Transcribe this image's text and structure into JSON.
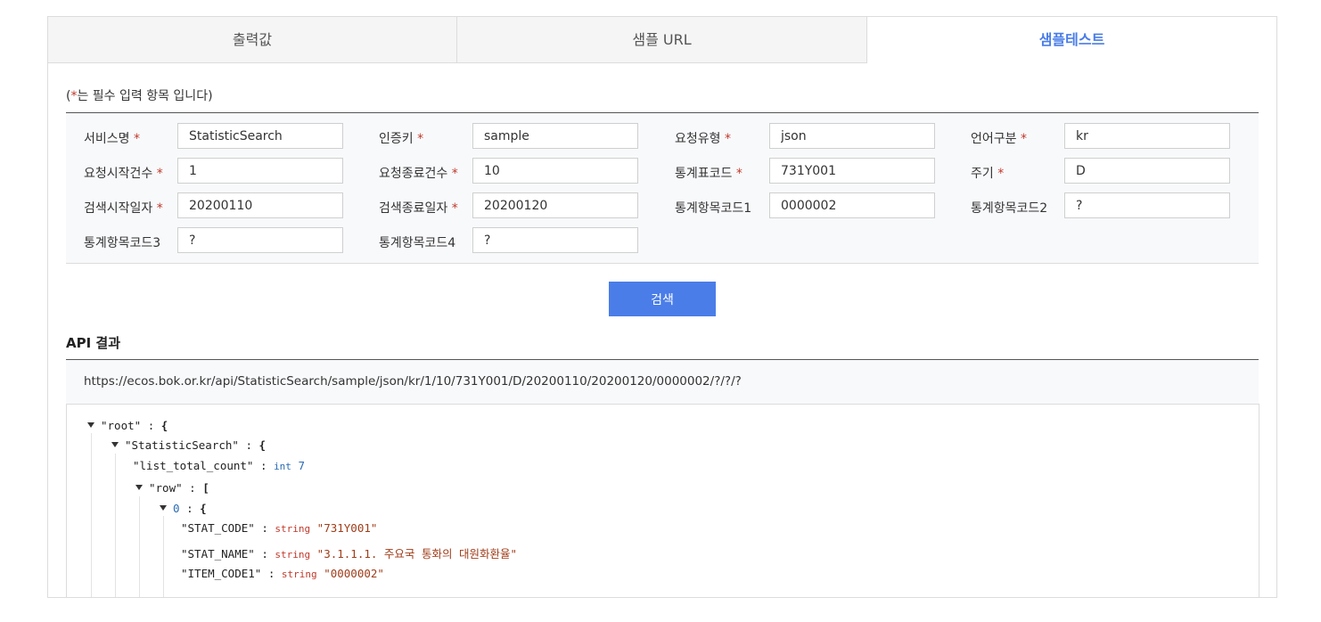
{
  "tabs": [
    {
      "label": "출력값"
    },
    {
      "label": "샘플 URL"
    },
    {
      "label": "샘플테스트"
    }
  ],
  "note": {
    "prefix": "(",
    "star": "*",
    "suffix": "는 필수 입력 항목 입니다)"
  },
  "form": {
    "service_name": {
      "label": "서비스명",
      "value": "StatisticSearch"
    },
    "auth_key": {
      "label": "인증키",
      "value": "sample"
    },
    "request_type": {
      "label": "요청유형",
      "value": "json"
    },
    "language": {
      "label": "언어구분",
      "value": "kr"
    },
    "start_count": {
      "label": "요청시작건수",
      "value": "1"
    },
    "end_count": {
      "label": "요청종료건수",
      "value": "10"
    },
    "stat_code": {
      "label": "통계표코드",
      "value": "731Y001"
    },
    "cycle": {
      "label": "주기",
      "value": "D"
    },
    "search_start": {
      "label": "검색시작일자",
      "value": "20200110"
    },
    "search_end": {
      "label": "검색종료일자",
      "value": "20200120"
    },
    "item_code1": {
      "label": "통계항목코드1",
      "value": "0000002"
    },
    "item_code2": {
      "label": "통계항목코드2",
      "value": "?"
    },
    "item_code3": {
      "label": "통계항목코드3",
      "value": "?"
    },
    "item_code4": {
      "label": "통계항목코드4",
      "value": "?"
    },
    "required_mark": "*"
  },
  "search_button": {
    "label": "검색"
  },
  "api_result": {
    "title": "API 결과",
    "url": "https://ecos.bok.or.kr/api/StatisticSearch/sample/json/kr/1/10/731Y001/D/20200110/20200120/0000002/?/?/?"
  },
  "json_tree": {
    "root_key": "\"root\"",
    "search_key": "\"StatisticSearch\"",
    "list_total_key": "\"list_total_count\"",
    "list_total_type": "int",
    "list_total_value": "7",
    "row_key": "\"row\"",
    "index_key": "0",
    "stat_code_key": "\"STAT_CODE\"",
    "stat_code_type": "string",
    "stat_code_value": "\"731Y001\"",
    "stat_name_key": "\"STAT_NAME\"",
    "stat_name_type": "string",
    "stat_name_value": "\"3.1.1.1. 주요국 통화의 대원화환율\"",
    "item_code1_key": "\"ITEM_CODE1\"",
    "item_code1_type": "string",
    "item_code1_value": "\"0000002\"",
    "colon": ":",
    "open_brace": "{",
    "open_bracket": "["
  }
}
